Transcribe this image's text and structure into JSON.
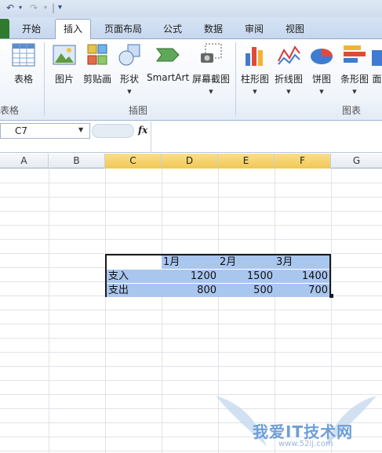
{
  "quick_access": {
    "undo": "↶",
    "redo": "↷",
    "customize": "▾"
  },
  "tabs": [
    {
      "label": "开始"
    },
    {
      "label": "插入"
    },
    {
      "label": "页面布局"
    },
    {
      "label": "公式"
    },
    {
      "label": "数据"
    },
    {
      "label": "审阅"
    },
    {
      "label": "视图"
    }
  ],
  "active_tab": "插入",
  "ribbon": {
    "groups": [
      {
        "label": "表格",
        "buttons": [
          {
            "label": "表格",
            "icon": "table-icon"
          }
        ]
      },
      {
        "label": "插图",
        "buttons": [
          {
            "label": "图片",
            "icon": "picture-icon"
          },
          {
            "label": "剪贴画",
            "icon": "clipart-icon"
          },
          {
            "label": "形状",
            "icon": "shapes-icon"
          },
          {
            "label": "SmartArt",
            "icon": "smartart-icon"
          },
          {
            "label": "屏幕截图",
            "icon": "screenshot-icon"
          }
        ]
      },
      {
        "label": "图表",
        "buttons": [
          {
            "label": "柱形图",
            "icon": "column-chart-icon"
          },
          {
            "label": "折线图",
            "icon": "line-chart-icon"
          },
          {
            "label": "饼图",
            "icon": "pie-chart-icon"
          },
          {
            "label": "条形图",
            "icon": "bar-chart-icon"
          },
          {
            "label": "面",
            "icon": "area-chart-icon"
          }
        ]
      }
    ]
  },
  "formula_bar": {
    "name_box": "C7",
    "fx": "fx",
    "value": ""
  },
  "columns": [
    "A",
    "B",
    "C",
    "D",
    "E",
    "F",
    "G"
  ],
  "selected_columns": [
    "C",
    "D",
    "E",
    "F"
  ],
  "sheet": {
    "header_row": [
      "",
      "1月",
      "2月",
      "3月"
    ],
    "rows": [
      {
        "label": "支入",
        "values": [
          "1200",
          "1500",
          "1400"
        ]
      },
      {
        "label": "支出",
        "values": [
          "800",
          "500",
          "700"
        ]
      }
    ]
  },
  "watermark": {
    "text": "我爱IT技术网",
    "url": "www.52ij.com"
  },
  "colors": {
    "selection_fill": "#a9c6ef",
    "header_selected": "#f2c754",
    "accent": "#2f7a2f"
  }
}
